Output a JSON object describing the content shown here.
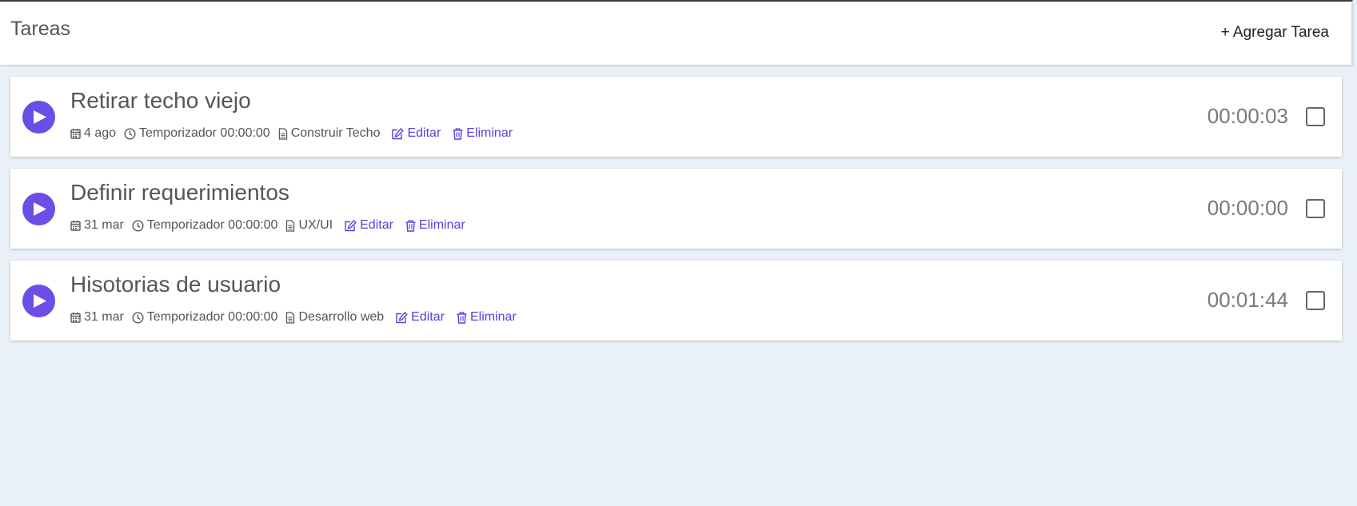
{
  "header": {
    "title": "Tareas",
    "add_task_label": "+ Agregar Tarea"
  },
  "tasks": [
    {
      "title": "Retirar techo viejo",
      "date": "4 ago",
      "timer_label": "Temporizador 00:00:00",
      "project": "Construir Techo",
      "edit_label": "Editar",
      "delete_label": "Eliminar",
      "elapsed": "00:00:03"
    },
    {
      "title": "Definir requerimientos",
      "date": "31 mar",
      "timer_label": "Temporizador 00:00:00",
      "project": "UX/UI",
      "edit_label": "Editar",
      "delete_label": "Eliminar",
      "elapsed": "00:00:00"
    },
    {
      "title": "Hisotorias de usuario",
      "date": "31 mar",
      "timer_label": "Temporizador 00:00:00",
      "project": "Desarrollo web",
      "edit_label": "Editar",
      "delete_label": "Eliminar",
      "elapsed": "00:01:44"
    }
  ],
  "icons": {
    "play": "play-icon",
    "date": "calendar-icon",
    "timer": "clock-icon",
    "project": "document-icon",
    "edit": "edit-icon",
    "delete": "trash-icon"
  },
  "colors": {
    "accent": "#6a4ee6",
    "link": "#5a3fd8",
    "background": "#eaf0f7",
    "card": "#ffffff",
    "text": "#555555"
  }
}
